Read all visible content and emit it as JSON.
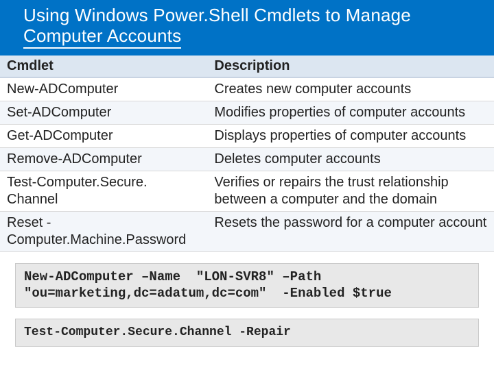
{
  "header": {
    "title_line1": "Using Windows Power.Shell Cmdlets to Manage",
    "title_line2": "Computer Accounts"
  },
  "table": {
    "columns": [
      "Cmdlet",
      " Description"
    ],
    "rows": [
      {
        "cmdlet": "New-ADComputer",
        "desc": "Creates new computer accounts"
      },
      {
        "cmdlet": "Set-ADComputer",
        "desc": "Modifies properties of computer accounts"
      },
      {
        "cmdlet": "Get-ADComputer",
        "desc": "Displays properties of computer accounts"
      },
      {
        "cmdlet": "Remove-ADComputer",
        "desc": "Deletes computer accounts"
      },
      {
        "cmdlet": "Test-Computer.Secure. Channel",
        "desc": "Verifies or repairs the trust relationship between a computer and the domain"
      },
      {
        "cmdlet": "Reset -Computer.Machine.Password",
        "desc": "Resets the password for a computer account"
      }
    ]
  },
  "code_examples": {
    "ex1": "New-ADComputer –Name  \"LON-SVR8\" –Path \"ou=marketing,dc=adatum,dc=com\"  -Enabled $true",
    "ex2": "Test-Computer.Secure.Channel -Repair"
  }
}
